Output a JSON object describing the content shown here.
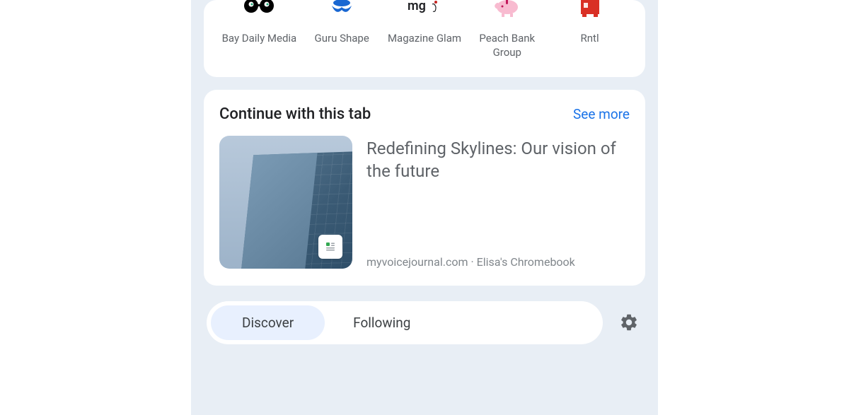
{
  "shortcuts": {
    "items": [
      {
        "name": "bay-daily-media",
        "label": "Bay Daily Media"
      },
      {
        "name": "guru-shape",
        "label": "Guru Shape"
      },
      {
        "name": "magazine-glam",
        "label": "Magazine Glam"
      },
      {
        "name": "peach-bank-group",
        "label": "Peach Bank Group"
      },
      {
        "name": "rntl",
        "label": "Rntl"
      }
    ]
  },
  "continue": {
    "title": "Continue with this tab",
    "see_more": "See more",
    "tab_title": "Redefining Skylines: Our vision of the future",
    "source": "myvoicejournal.com · Elisa's Chromebook"
  },
  "feed_tabs": {
    "discover": "Discover",
    "following": "Following"
  }
}
